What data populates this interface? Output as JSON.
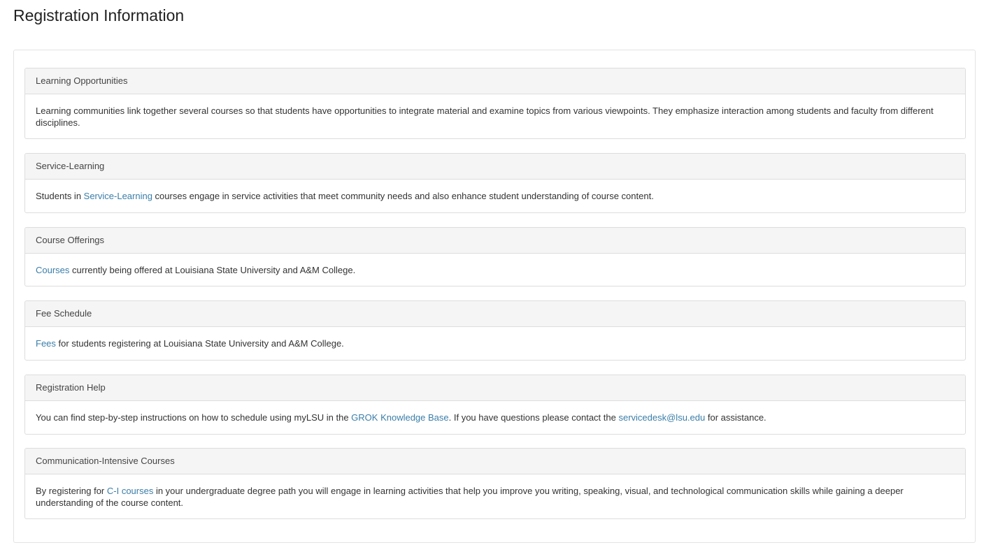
{
  "page": {
    "title": "Registration Information"
  },
  "sections": [
    {
      "heading": "Learning Opportunities",
      "text": "Learning communities link together several courses so that students have opportunities to integrate material and examine topics from various viewpoints. They emphasize interaction among students and faculty from different disciplines."
    },
    {
      "heading": "Service-Learning",
      "prefix": "Students in ",
      "link": "Service-Learning",
      "suffix": " courses engage in service activities that meet community needs and also enhance student understanding of course content."
    },
    {
      "heading": "Course Offerings",
      "link": "Courses",
      "suffix": " currently being offered at Louisiana State University and A&M College."
    },
    {
      "heading": "Fee Schedule",
      "link": "Fees",
      "suffix": " for students registering at Louisiana State University and A&M College."
    },
    {
      "heading": "Registration Help",
      "prefix": "You can find step-by-step instructions on how to schedule using myLSU in the ",
      "link": "GROK Knowledge Base",
      "middle": ". If you have questions please contact the ",
      "link2": "servicedesk@lsu.edu",
      "suffix": " for assistance."
    },
    {
      "heading": "Communication-Intensive Courses",
      "prefix": "By registering for ",
      "link": "C-I courses",
      "suffix": " in your undergraduate degree path you will engage in learning activities that help you improve you writing, speaking, visual, and technological communication skills while gaining a deeper understanding of the course content."
    }
  ],
  "colors": {
    "link": "#3a7ea8",
    "header_bg": "#f5f5f5",
    "border": "#dddddd"
  }
}
